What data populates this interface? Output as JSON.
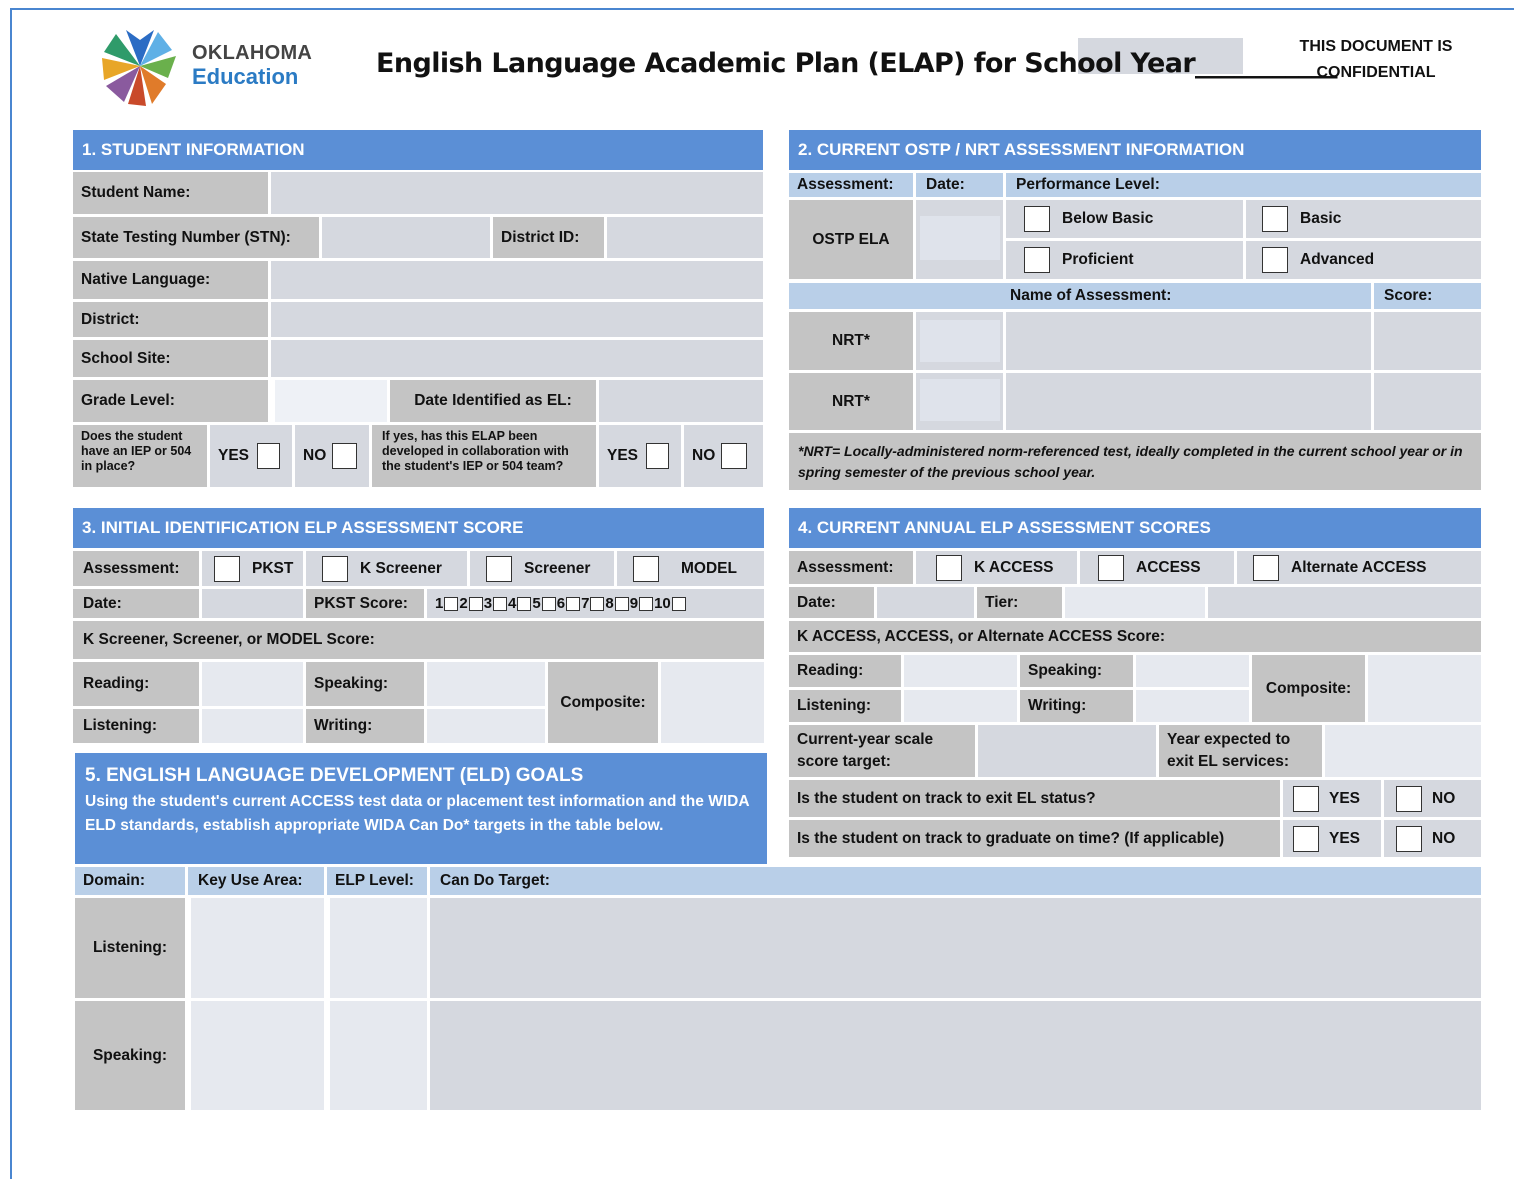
{
  "header": {
    "logo_line1": "OKLAHOMA",
    "logo_line2": "Education",
    "title": "English Language Academic Plan (ELAP) for School Year___________",
    "confidential_line1": "THIS DOCUMENT IS",
    "confidential_line2": "CONFIDENTIAL"
  },
  "s1": {
    "heading": "1. STUDENT INFORMATION",
    "student_name": "Student Name:",
    "stn": "State Testing Number (STN):",
    "district_id": "District ID:",
    "native_language": "Native Language:",
    "district": "District:",
    "school_site": "School Site:",
    "grade_level": "Grade Level:",
    "date_identified": "Date Identified as EL:",
    "iep_question": "Does the student have an IEP or 504 in place?",
    "collab_question": "If yes, has this ELAP been developed in collaboration with the student's IEP or 504 team?",
    "yes": "YES",
    "no": "NO"
  },
  "s2": {
    "heading": "2. CURRENT OSTP / NRT ASSESSMENT INFORMATION",
    "assessment": "Assessment:",
    "date": "Date:",
    "performance_level": "Performance Level:",
    "ostp_ela": "OSTP ELA",
    "below_basic": "Below Basic",
    "basic": "Basic",
    "proficient": "Proficient",
    "advanced": "Advanced",
    "name_of_assessment": "Name of Assessment:",
    "score": "Score:",
    "nrt1": "NRT*",
    "nrt2": "NRT*",
    "note": "*NRT= Locally-administered norm-referenced test, ideally completed in the current school year or in spring semester of the previous school year."
  },
  "s3": {
    "heading": "3. INITIAL IDENTIFICATION ELP ASSESSMENT SCORE",
    "assessment": "Assessment:",
    "pkst": "PKST",
    "k_screener": "K Screener",
    "screener": "Screener",
    "model": "MODEL",
    "date": "Date:",
    "pkst_score": "PKST Score:",
    "score_numbers": [
      "1",
      "2",
      "3",
      "4",
      "5",
      "6",
      "7",
      "8",
      "9",
      "10"
    ],
    "k_screener_score": "K Screener, Screener, or MODEL Score:",
    "reading": "Reading:",
    "speaking": "Speaking:",
    "listening": "Listening:",
    "writing": "Writing:",
    "composite": "Composite:"
  },
  "s4": {
    "heading": "4. CURRENT ANNUAL ELP ASSESSMENT SCORES",
    "assessment": "Assessment:",
    "k_access": "K ACCESS",
    "access": "ACCESS",
    "alt_access": "Alternate ACCESS",
    "date": "Date:",
    "tier": "Tier:",
    "score_label": "K ACCESS, ACCESS, or Alternate ACCESS Score:",
    "reading": "Reading:",
    "speaking": "Speaking:",
    "listening": "Listening:",
    "writing": "Writing:",
    "composite": "Composite:",
    "scale_target": "Current-year scale score target:",
    "year_expected": "Year expected to exit EL services:",
    "on_track_exit": "Is the student on track to exit EL status?",
    "on_track_grad": "Is the student on track to graduate on time? (If applicable)",
    "yes": "YES",
    "no": "NO"
  },
  "s5": {
    "heading": "5. ENGLISH LANGUAGE DEVELOPMENT (ELD) GOALS",
    "description": "Using the student's current ACCESS test data or placement test information and the WIDA ELD standards, establish appropriate WIDA Can Do* targets in the table below.",
    "domain": "Domain:",
    "key_use_area": "Key Use Area:",
    "elp_level": "ELP Level:",
    "can_do_target": "Can Do Target:",
    "listening": "Listening:",
    "speaking": "Speaking:"
  }
}
